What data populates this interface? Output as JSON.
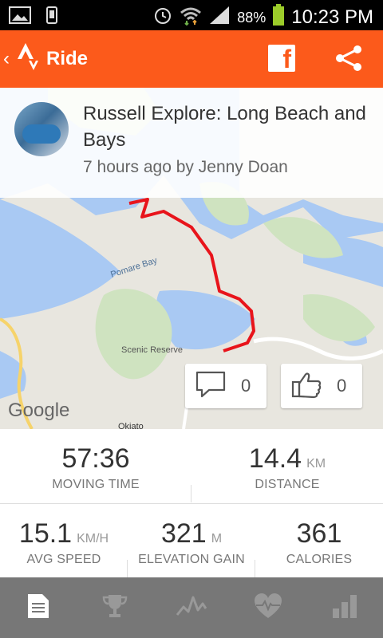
{
  "status_bar": {
    "battery_percent": "88%",
    "time": "10:23 PM"
  },
  "app_bar": {
    "title": "Ride",
    "facebook_label": "f",
    "icons": [
      "back-chevron-icon",
      "strava-logo-icon",
      "facebook-icon",
      "share-icon"
    ],
    "color": "#fc5a1b"
  },
  "activity": {
    "title": "Russell Explore: Long Beach and Bays",
    "meta": "7 hours ago by Jenny Doan"
  },
  "map": {
    "labels": {
      "pomare_bay": "Pomare Bay",
      "scenic_reserve": "Scenic Reserve",
      "google": "Google",
      "okiato": "Okiato"
    },
    "route_color": "#e8141b"
  },
  "social": {
    "comments_count": "0",
    "kudos_count": "0"
  },
  "stats": {
    "moving_time": {
      "value": "57:36",
      "label": "MOVING TIME"
    },
    "distance": {
      "value": "14.4",
      "unit": "KM",
      "label": "DISTANCE"
    },
    "avg_speed": {
      "value": "15.1",
      "unit": "KM/H",
      "label": "AVG SPEED"
    },
    "elevation_gain": {
      "value": "321",
      "unit": "M",
      "label": "ELEVATION GAIN"
    },
    "calories": {
      "value": "361",
      "label": "CALORIES"
    }
  },
  "bottom_nav": {
    "items": [
      "overview-tab",
      "achievements-tab",
      "analysis-tab",
      "heart-rate-tab",
      "segments-tab"
    ],
    "selected": "overview-tab"
  }
}
